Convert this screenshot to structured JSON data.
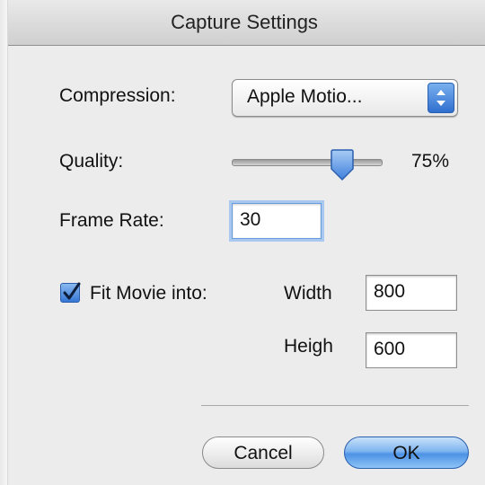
{
  "window": {
    "title": "Capture Settings"
  },
  "compression": {
    "label": "Compression:",
    "selected": "Apple Motio..."
  },
  "quality": {
    "label": "Quality:",
    "value_text": "75%",
    "level": 0.75
  },
  "frame_rate": {
    "label": "Frame Rate:",
    "value": "30"
  },
  "fit_movie": {
    "label": "Fit Movie into:",
    "checked": true,
    "width_label": "Width",
    "width_value": "800",
    "height_label": "Heigh",
    "height_value": "600"
  },
  "buttons": {
    "cancel": "Cancel",
    "ok": "OK"
  },
  "colors": {
    "accent": "#3677d6",
    "focus_ring": "#a8c8f0"
  }
}
